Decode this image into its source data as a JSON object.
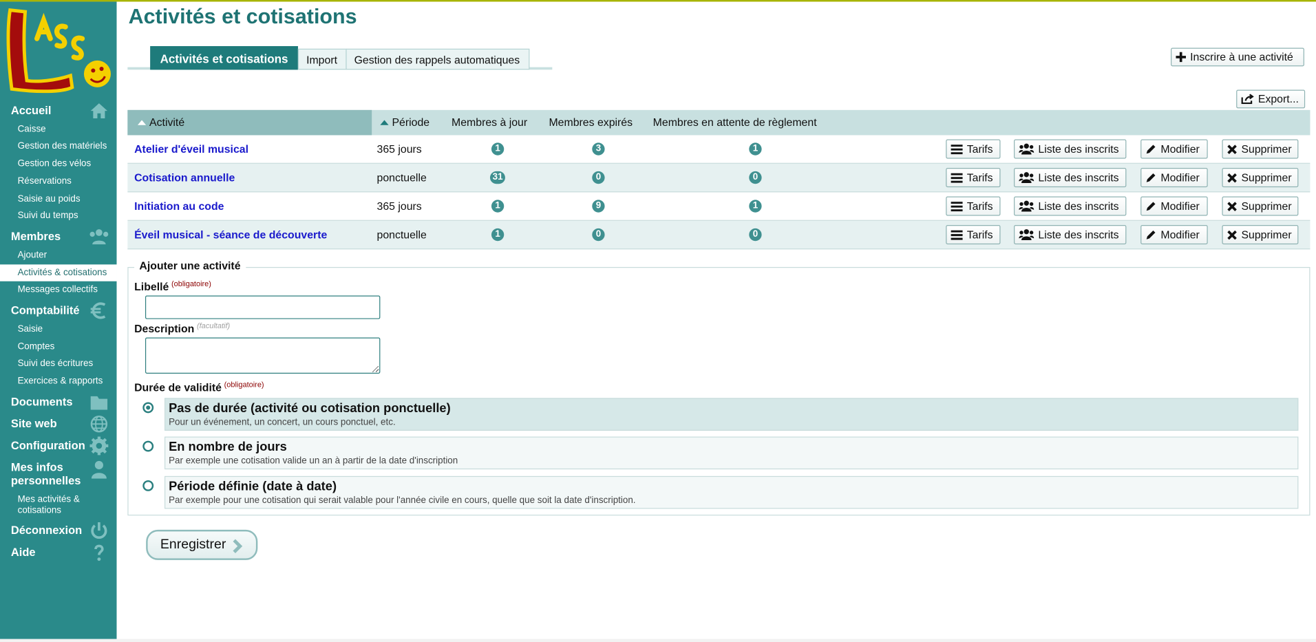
{
  "page": {
    "title": "Activités et cotisations"
  },
  "tabs": [
    {
      "label": "Activités et cotisations"
    },
    {
      "label": "Import"
    },
    {
      "label": "Gestion des rappels automatiques"
    }
  ],
  "actions": {
    "subscribe": "Inscrire à une activité",
    "export": "Export..."
  },
  "sidebar": {
    "accueil": {
      "label": "Accueil",
      "icon": "home-icon"
    },
    "accueil_items": [
      "Caisse",
      "Gestion des matériels",
      "Gestion des vélos",
      "Réservations",
      "Saisie au poids",
      "Suivi du temps"
    ],
    "membres": {
      "label": "Membres",
      "icon": "users-icon"
    },
    "membres_items": [
      "Ajouter",
      "Activités & cotisations",
      "Messages collectifs"
    ],
    "compta": {
      "label": "Comptabilité",
      "icon": "euro-icon"
    },
    "compta_items": [
      "Saisie",
      "Comptes",
      "Suivi des écritures",
      "Exercices & rapports"
    ],
    "documents": {
      "label": "Documents",
      "icon": "folder-icon"
    },
    "siteweb": {
      "label": "Site web",
      "icon": "globe-icon"
    },
    "config": {
      "label": "Configuration",
      "icon": "gear-icon"
    },
    "mesinfos": {
      "label_1": "Mes infos",
      "label_2": "personnelles",
      "icon": "user-icon"
    },
    "mesinfos_items": {
      "line1": "Mes activités &",
      "line2": "cotisations"
    },
    "deconnexion": {
      "label": "Déconnexion",
      "icon": "power-icon"
    },
    "aide": {
      "label": "Aide",
      "icon": "question-icon"
    }
  },
  "table": {
    "headers": [
      "Activité",
      "Période",
      "Membres à jour",
      "Membres expirés",
      "Membres en attente de règlement"
    ],
    "rows": [
      {
        "name": "Atelier d'éveil musical",
        "period": "365 jours",
        "a_jour": "1",
        "expires": "3",
        "attente": "1"
      },
      {
        "name": "Cotisation annuelle",
        "period": "ponctuelle",
        "a_jour": "31",
        "expires": "0",
        "attente": "0"
      },
      {
        "name": "Initiation au code",
        "period": "365 jours",
        "a_jour": "1",
        "expires": "9",
        "attente": "1"
      },
      {
        "name": "Éveil musical - séance de découverte",
        "period": "ponctuelle",
        "a_jour": "1",
        "expires": "0",
        "attente": "0"
      }
    ],
    "row_buttons": {
      "tarifs": "Tarifs",
      "inscrits": "Liste des inscrits",
      "modifier": "Modifier",
      "supprimer": "Supprimer"
    }
  },
  "form": {
    "legend": "Ajouter une activité",
    "libelle_label": "Libellé",
    "required": "(obligatoire)",
    "optional": "(facultatif)",
    "description_label": "Description",
    "libelle_value": "",
    "description_value": "",
    "duree_label": "Durée de validité",
    "options": [
      {
        "title": "Pas de durée (activité ou cotisation ponctuelle)",
        "desc": "Pour un événement, un concert, un cours ponctuel, etc.",
        "selected": true
      },
      {
        "title": "En nombre de jours",
        "desc": "Par exemple une cotisation valide un an à partir de la date d'inscription",
        "selected": false
      },
      {
        "title": "Période définie (date à date)",
        "desc": "Par exemple pour une cotisation qui serait valable pour l'année civile en cours, quelle que soit la date d'inscription.",
        "selected": false
      }
    ],
    "save": "Enregistrer"
  },
  "colors": {
    "sidebar": "#2a8a8a",
    "accent": "#1e7b7b",
    "link": "#1a1acc",
    "header_bg": "#c8e0e0"
  }
}
